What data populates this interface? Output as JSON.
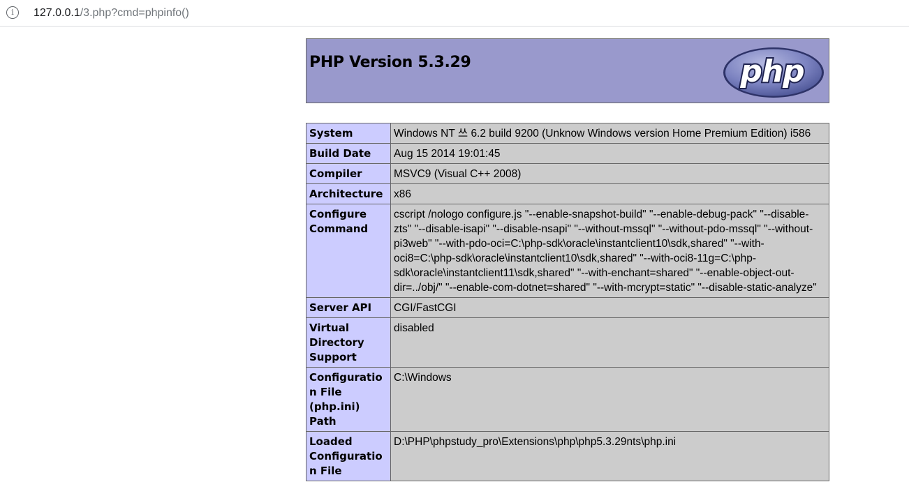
{
  "browser": {
    "url_host": "127.0.0.1",
    "url_path": "/3.php?cmd=phpinfo()",
    "info_icon": "i"
  },
  "header": {
    "title": "PHP Version 5.3.29",
    "logo_text": "php",
    "background_color": "#9999cc"
  },
  "table": {
    "key_color": "#ccccff",
    "value_color": "#cccccc",
    "rows": [
      {
        "key": "System",
        "value": "Windows NT 쓰 6.2 build 9200 (Unknow Windows version Home Premium Edition) i586"
      },
      {
        "key": "Build Date",
        "value": "Aug 15 2014 19:01:45"
      },
      {
        "key": "Compiler",
        "value": "MSVC9 (Visual C++ 2008)"
      },
      {
        "key": "Architecture",
        "value": "x86"
      },
      {
        "key": "Configure Command",
        "value": "cscript /nologo configure.js \"--enable-snapshot-build\" \"--enable-debug-pack\" \"--disable-zts\" \"--disable-isapi\" \"--disable-nsapi\" \"--without-mssql\" \"--without-pdo-mssql\" \"--without-pi3web\" \"--with-pdo-oci=C:\\php-sdk\\oracle\\instantclient10\\sdk,shared\" \"--with-oci8=C:\\php-sdk\\oracle\\instantclient10\\sdk,shared\" \"--with-oci8-11g=C:\\php-sdk\\oracle\\instantclient11\\sdk,shared\" \"--with-enchant=shared\" \"--enable-object-out-dir=../obj/\" \"--enable-com-dotnet=shared\" \"--with-mcrypt=static\" \"--disable-static-analyze\""
      },
      {
        "key": "Server API",
        "value": "CGI/FastCGI"
      },
      {
        "key": "Virtual Directory Support",
        "value": "disabled"
      },
      {
        "key": "Configuration File (php.ini) Path",
        "value": "C:\\Windows"
      },
      {
        "key": "Loaded Configuration File",
        "value": "D:\\PHP\\phpstudy_pro\\Extensions\\php\\php5.3.29nts\\php.ini"
      }
    ]
  }
}
